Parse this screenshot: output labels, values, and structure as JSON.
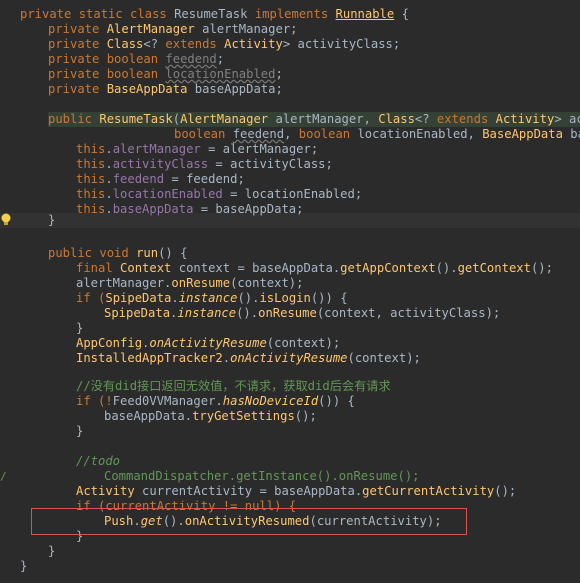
{
  "code": {
    "l01": "private static class ResumeTask implements Runnable {",
    "l02a": "private ",
    "l02b": "AlertManager",
    "l02c": " alertManager;",
    "l03a": "private ",
    "l03b": "Class",
    "l03c": "<? ",
    "l03d": "extends ",
    "l03e": "Activity",
    "l03f": "> activityClass;",
    "l04a": "private boolean ",
    "l04b": "feedend",
    "l04c": ";",
    "l05a": "private boolean ",
    "l05b": "locationEnabled",
    "l05c": ";",
    "l06a": "private ",
    "l06b": "BaseAppData",
    "l06c": " baseAppData;",
    "l08a": "public ",
    "l08b": "ResumeTask",
    "l08c": "(",
    "l08d": "AlertManager",
    "l08e": " alertManager, ",
    "l08f": "Class",
    "l08g": "<? ",
    "l08h": "extends ",
    "l08i": "Activity",
    "l08j": "> activi",
    "l09a": "boolean ",
    "l09b": "feedend",
    "l09c": ", ",
    "l09d": "boolean ",
    "l09e": "locationEnabled, ",
    "l09f": "BaseAppData",
    "l09g": " baseA",
    "l10": "this.alertManager = alertManager;",
    "l11": "this.activityClass = activityClass;",
    "l12": "this.feedend = feedend;",
    "l13": "this.locationEnabled = locationEnabled;",
    "l14": "this.baseAppData = baseAppData;",
    "l15": "}",
    "l17a": "public void ",
    "l17b": "run",
    "l17c": "() {",
    "l18a": "final ",
    "l18b": "Context",
    "l18c": " context = baseAppData.",
    "l18d": "getAppContext",
    "l18e": "().",
    "l18f": "getContext",
    "l18g": "();",
    "l19a": "alertManager.",
    "l19b": "onResume",
    "l19c": "(context);",
    "l20a": "if (",
    "l20b": "SpipeData",
    "l20c": ".",
    "l20d": "instance",
    "l20e": "().",
    "l20f": "isLogin",
    "l20g": "()) {",
    "l21a": "SpipeData",
    "l21b": ".",
    "l21c": "instance",
    "l21d": "().",
    "l21e": "onResume",
    "l21f": "(context, activityClass);",
    "l22": "}",
    "l23a": "AppConfig",
    "l23b": ".",
    "l23c": "onActivityResume",
    "l23d": "(context);",
    "l24a": "InstalledAppTracker2",
    "l24b": ".",
    "l24c": "onActivityResume",
    "l24d": "(context);",
    "l26": "//没有did接口返回无效值，不请求，获取did后会有请求",
    "l27a": "if (!",
    "l27b": "Feed0VVManager",
    "l27c": ".",
    "l27d": "hasNoDeviceId",
    "l27e": "()) {",
    "l28a": "baseAppData.",
    "l28b": "tryGetSettings",
    "l28c": "();",
    "l29": "}",
    "l31": "//todo",
    "l32": "CommandDispatcher.getInstance().onResume();",
    "l33a": "Activity",
    "l33b": " currentActivity = baseAppData.",
    "l33c": "getCurrentActivity",
    "l33d": "();",
    "l34": "if (currentActivity != null) {",
    "l35a": "Push",
    "l35b": ".",
    "l35c": "get",
    "l35d": "().",
    "l35e": "onActivityResumed",
    "l35f": "(currentActivity);",
    "l36": "}",
    "l37": "}",
    "l38": "}"
  },
  "gutter": {
    "bulb_icon": "lightbulb-icon",
    "fold_mark": "/"
  },
  "colors": {
    "background": "#2b2b2b",
    "highlight_box": "#d9544f"
  }
}
